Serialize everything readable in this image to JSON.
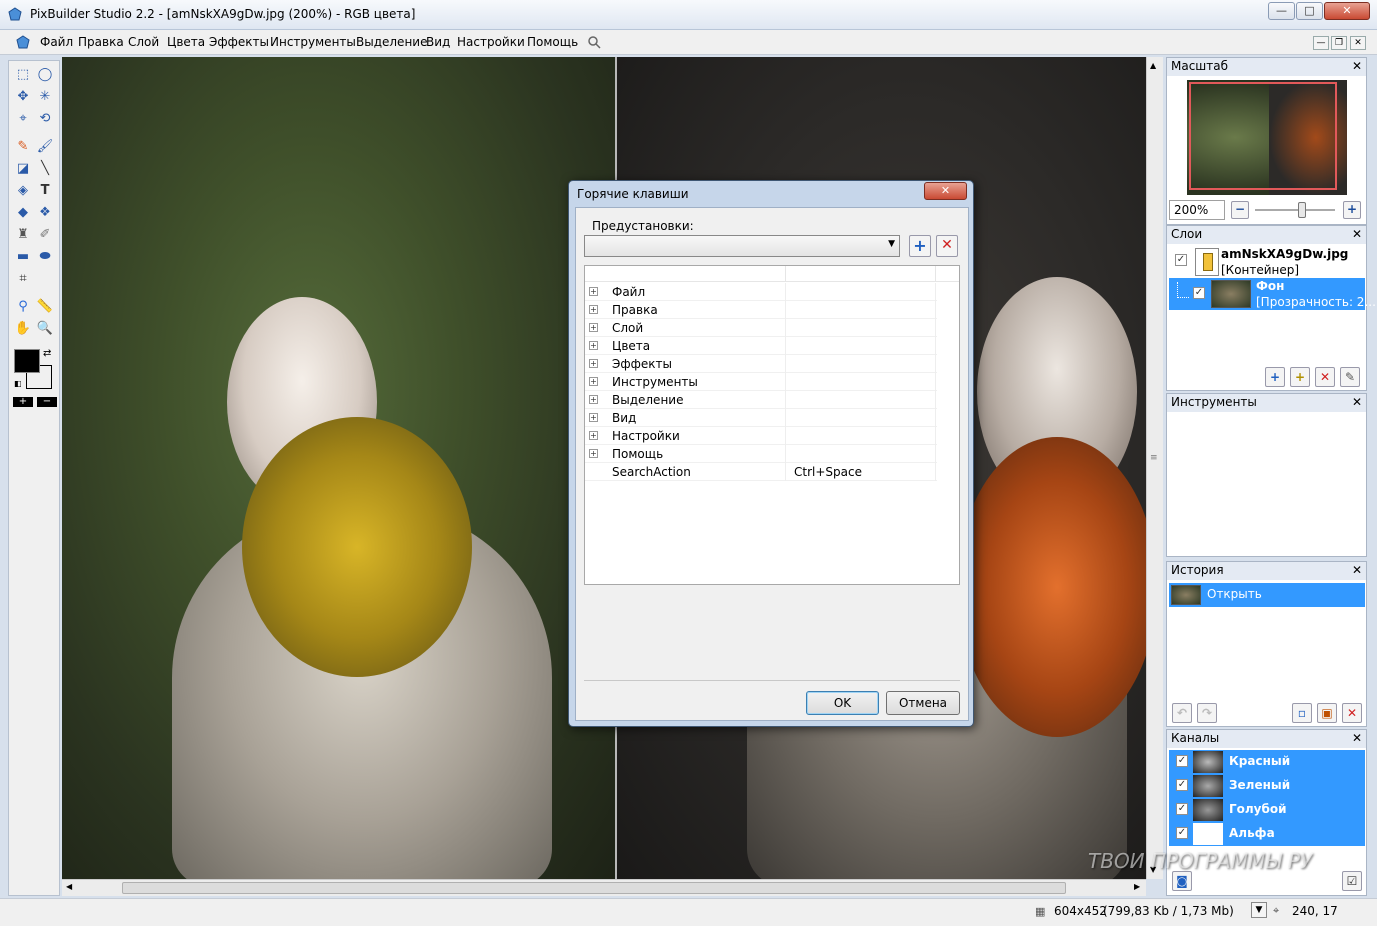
{
  "window": {
    "title": "PixBuilder Studio 2.2 - [amNskXA9gDw.jpg (200%) - RGB цвета]",
    "minimize": "—",
    "maximize": "□",
    "close": "✕"
  },
  "menu": {
    "items": [
      "Файл",
      "Правка",
      "Слой",
      "Цвета",
      "Эффекты",
      "Инструменты",
      "Выделение",
      "Вид",
      "Настройки",
      "Помощь"
    ],
    "mdi_min": "—",
    "mdi_restore": "❐",
    "mdi_close": "✕"
  },
  "panels": {
    "scale": {
      "title": "Масштаб",
      "zoom_value": "200%",
      "minus": "−",
      "plus": "+"
    },
    "layers": {
      "title": "Слои",
      "container_name": "amNskXA9gDw.jpg",
      "container_sub": "[Контейнер]",
      "layer_name": "Фон",
      "layer_sub": "[Прозрачность: 2..."
    },
    "tools": {
      "title": "Инструменты"
    },
    "history": {
      "title": "История",
      "item": "Открыть"
    },
    "channels": {
      "title": "Каналы",
      "items": [
        "Красный",
        "Зеленый",
        "Голубой",
        "Альфа"
      ]
    },
    "close_glyph": "✕"
  },
  "dialog": {
    "title": "Горячие клавиши",
    "presets_label": "Предустановки:",
    "presets_value": "",
    "add": "+",
    "delete": "✕",
    "tree": [
      {
        "name": "Файл",
        "key": "",
        "expandable": true
      },
      {
        "name": "Правка",
        "key": "",
        "expandable": true
      },
      {
        "name": "Слой",
        "key": "",
        "expandable": true
      },
      {
        "name": "Цвета",
        "key": "",
        "expandable": true
      },
      {
        "name": "Эффекты",
        "key": "",
        "expandable": true
      },
      {
        "name": "Инструменты",
        "key": "",
        "expandable": true
      },
      {
        "name": "Выделение",
        "key": "",
        "expandable": true
      },
      {
        "name": "Вид",
        "key": "",
        "expandable": true
      },
      {
        "name": "Настройки",
        "key": "",
        "expandable": true
      },
      {
        "name": "Помощь",
        "key": "",
        "expandable": true
      },
      {
        "name": "SearchAction",
        "key": "Ctrl+Space",
        "expandable": false
      }
    ],
    "ok": "OK",
    "cancel": "Отмена"
  },
  "status": {
    "dimensions": "604x452",
    "filesize": "(799,83 Kb / 1,73 Mb)",
    "coords": "240, 17"
  },
  "watermark": "ТВОИ ПРОГРАММЫ РУ",
  "colors": {
    "selection": "#3399ff",
    "foreground": "#000000",
    "background": "#ffffff"
  }
}
